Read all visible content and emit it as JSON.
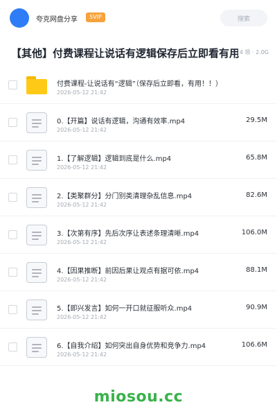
{
  "header": {
    "brand": "夸克网盘分享",
    "badge": "SVIP",
    "search_label": "搜索",
    "colors": {
      "avatar": "#2f7df6",
      "badge": "#f7a23b"
    }
  },
  "share": {
    "title": "【其他】付费课程让说话有逻辑保存后立即看有用",
    "summary": "4 项 · 2.0G"
  },
  "items": [
    {
      "type": "folder",
      "name": "付费课程-让说话有“逻辑”（保存后立即看，有用！！）",
      "date": "2026-05-12 21:42",
      "size": ""
    },
    {
      "type": "file",
      "name": "0.【开篇】说话有逻辑，沟通有效率.mp4",
      "date": "2026-05-12 21:42",
      "size": "29.5M"
    },
    {
      "type": "file",
      "name": "1.【了解逻辑】逻辑到底是什么.mp4",
      "date": "2026-05-12 21:42",
      "size": "65.8M"
    },
    {
      "type": "file",
      "name": "2.【类聚群分】分门别类清理杂乱信息.mp4",
      "date": "2026-05-12 21:42",
      "size": "82.6M"
    },
    {
      "type": "file",
      "name": "3.【次第有序】先后次序让表述条理清晰.mp4",
      "date": "2026-05-12 21:42",
      "size": "106.0M"
    },
    {
      "type": "file",
      "name": "4.【因果推断】前因后果让观点有据可依.mp4",
      "date": "2026-05-12 21:42",
      "size": "88.1M"
    },
    {
      "type": "file",
      "name": "5.【即兴发言】如何一开口就征服听众.mp4",
      "date": "2026-05-12 21:42",
      "size": "90.9M"
    },
    {
      "type": "file",
      "name": "6.【自我介绍】如何突出自身优势和竞争力.mp4",
      "date": "2026-05-12 21:42",
      "size": "106.6M"
    }
  ],
  "footer": {
    "watermark": "miosou.cc",
    "color": "#38b24a"
  }
}
